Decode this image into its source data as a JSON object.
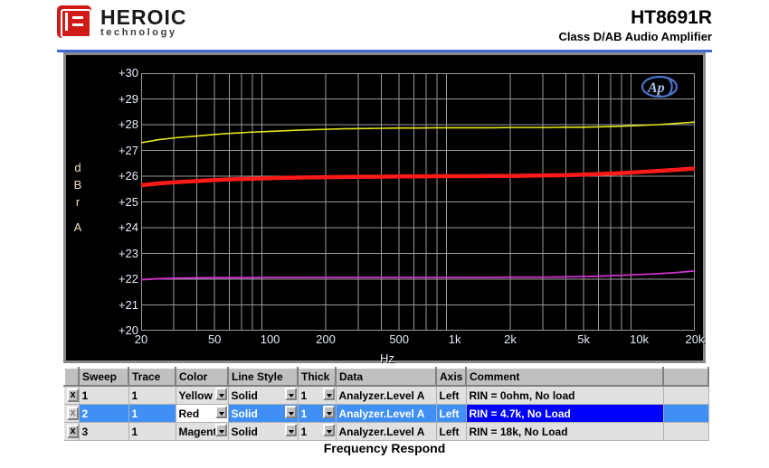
{
  "header": {
    "brand_name": "HEROIC",
    "brand_tagline": "technology",
    "part_number": "HT8691R",
    "subtitle": "Class D/AB Audio Amplifier"
  },
  "caption": "Frequency Respond",
  "chart_panel": {
    "ap_logo_text": "AP"
  },
  "chart_data": {
    "type": "line",
    "title": "Frequency Respond",
    "xlabel": "Hz",
    "ylabel": "dBrA",
    "xscale": "log",
    "xlim": [
      20,
      20000
    ],
    "ylim": [
      20,
      30
    ],
    "xticks": [
      "20",
      "50",
      "100",
      "200",
      "500",
      "1k",
      "2k",
      "5k",
      "10k",
      "20k"
    ],
    "xtick_values": [
      20,
      50,
      100,
      200,
      500,
      1000,
      2000,
      5000,
      10000,
      20000
    ],
    "yticks": [
      "+20",
      "+21",
      "+22",
      "+23",
      "+24",
      "+25",
      "+26",
      "+27",
      "+28",
      "+29",
      "+30"
    ],
    "ytick_values": [
      20,
      21,
      22,
      23,
      24,
      25,
      26,
      27,
      28,
      29,
      30
    ],
    "grid": true,
    "background": "#000000",
    "grid_color": "#9a9a9a",
    "legend": "none",
    "x": [
      20,
      25,
      31.5,
      40,
      50,
      63,
      80,
      100,
      125,
      160,
      200,
      250,
      315,
      400,
      500,
      630,
      800,
      1000,
      1250,
      1600,
      2000,
      2500,
      3150,
      4000,
      5000,
      6300,
      8000,
      10000,
      12500,
      16000,
      20000
    ],
    "series": [
      {
        "name": "Sweep 1 - RIN = 0ohm, No load",
        "color": "#e6e619",
        "thickness": 1.6,
        "values": [
          27.3,
          27.42,
          27.5,
          27.56,
          27.62,
          27.67,
          27.71,
          27.74,
          27.77,
          27.8,
          27.82,
          27.84,
          27.85,
          27.86,
          27.87,
          27.87,
          27.88,
          27.88,
          27.88,
          27.88,
          27.89,
          27.89,
          27.89,
          27.9,
          27.9,
          27.92,
          27.94,
          27.97,
          28.0,
          28.05,
          28.1
        ]
      },
      {
        "name": "Sweep 2 - RIN = 4.7k, No Load",
        "color": "#ff1a1a",
        "thickness": 4.5,
        "values": [
          25.65,
          25.72,
          25.77,
          25.81,
          25.85,
          25.88,
          25.9,
          25.92,
          25.94,
          25.95,
          25.96,
          25.97,
          25.98,
          25.98,
          25.99,
          25.99,
          26.0,
          26.0,
          26.0,
          26.01,
          26.01,
          26.02,
          26.03,
          26.04,
          26.06,
          26.09,
          26.12,
          26.16,
          26.2,
          26.25,
          26.3
        ]
      },
      {
        "name": "Sweep 3 - RIN = 18k, No Load",
        "color": "#cc33cc",
        "thickness": 1.8,
        "values": [
          21.98,
          22.02,
          22.04,
          22.05,
          22.06,
          22.06,
          22.06,
          22.07,
          22.07,
          22.07,
          22.07,
          22.07,
          22.07,
          22.07,
          22.07,
          22.07,
          22.07,
          22.07,
          22.07,
          22.07,
          22.08,
          22.08,
          22.08,
          22.09,
          22.1,
          22.12,
          22.15,
          22.18,
          22.21,
          22.26,
          22.32
        ]
      }
    ]
  },
  "table": {
    "columns": [
      "",
      "Sweep",
      "Trace",
      "Color",
      "Line Style",
      "Thick",
      "Data",
      "Axis",
      "Comment",
      ""
    ],
    "rows": [
      {
        "close": "x",
        "sweep": "1",
        "trace": "1",
        "color": "Yellow",
        "line_style": "Solid",
        "thick": "1",
        "data": "Analyzer.Level A",
        "axis": "Left",
        "comment": "RIN = 0ohm, No load",
        "selected": false
      },
      {
        "close": "x",
        "sweep": "2",
        "trace": "1",
        "color": "Red",
        "line_style": "Solid",
        "thick": "1",
        "data": "Analyzer.Level A",
        "axis": "Left",
        "comment": "RIN = 4.7k, No Load",
        "selected": true
      },
      {
        "close": "x",
        "sweep": "3",
        "trace": "1",
        "color": "Magenta",
        "line_style": "Solid",
        "thick": "1",
        "data": "Analyzer.Level A",
        "axis": "Left",
        "comment": "RIN = 18k, No Load",
        "selected": false
      }
    ]
  }
}
